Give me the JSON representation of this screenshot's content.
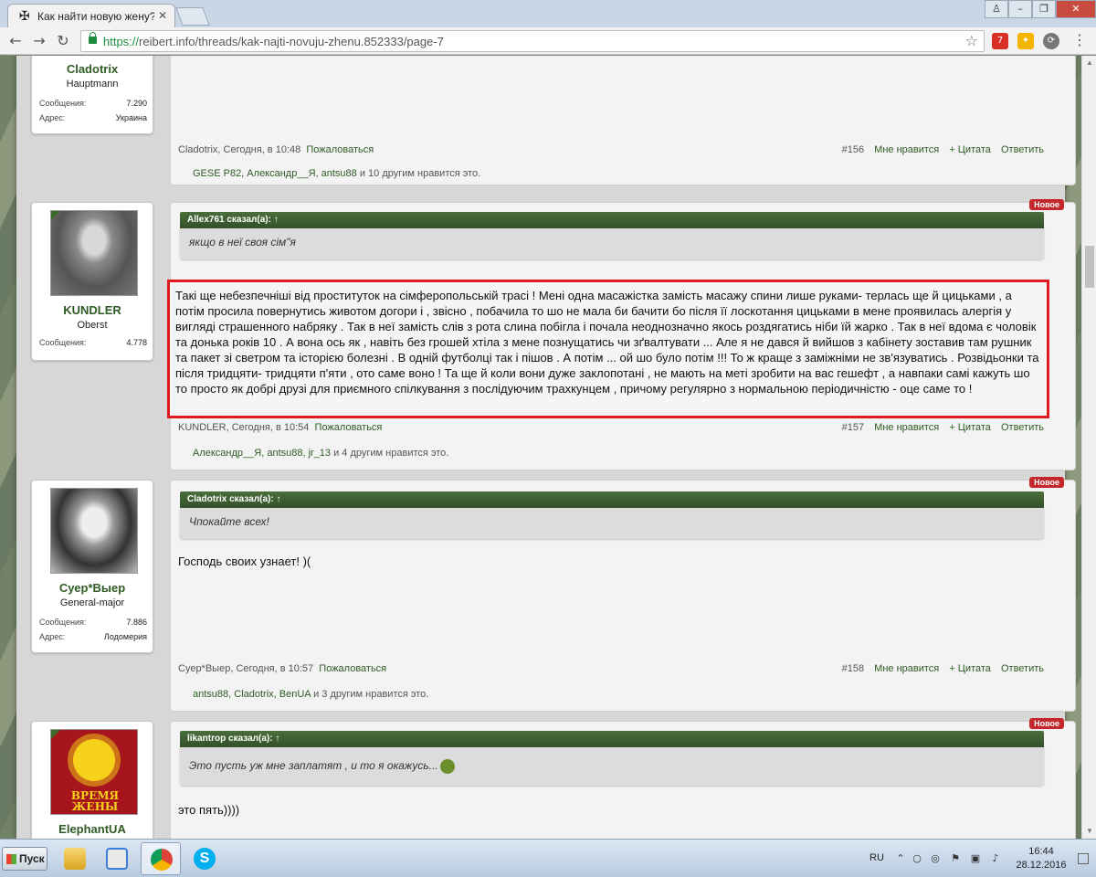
{
  "browser": {
    "tab_title": "Как найти новую жену?",
    "tab_icon": "iron-cross-icon",
    "url_scheme": "https://",
    "url_rest": "reibert.info/threads/kak-najti-novuju-zhenu.852333/page-7",
    "extension_badge": "7"
  },
  "labels": {
    "new_badge": "Новое",
    "report": "Пожаловаться",
    "like": "Мне нравится",
    "quote": "+ Цитата",
    "reply": "Ответить",
    "messages": "Сообщения:",
    "address": "Адрес:",
    "likes_suffix": "нравится это."
  },
  "posts": [
    {
      "user": {
        "name": "Cladotrix",
        "rank": "Hauptmann",
        "messages": "7.290",
        "address": "Украина"
      },
      "author": "Cladotrix",
      "time": "Сегодня, в 10:48",
      "number": "#156",
      "likes": "GESE P82, Александр__Я, antsu88 и 10 другим",
      "likes_names": "GESE P82, Александр__Я, antsu88",
      "likes_tail": " и 10 другим нравится это."
    },
    {
      "user": {
        "name": "KUNDLER",
        "rank": "Oberst",
        "messages": "4.778"
      },
      "quote_head": "Allex761 сказал(а): ↑",
      "quote_text": "якщо в неї своя сім\"я",
      "text": "Такі ще небезпечніші від проституток на сімферопольській трасі ! Мені одна масажістка замість масажу спини лише руками- терлась ще й цицьками , а потім просила повернутись животом догори і , звісно , побачила то шо не мала би бачити бо після її лоскотання цицьками в мене проявилась алергія у вигляді страшенного набряку . Так в неї замість слів з рота слина побігла і почала неоднозначно якось роздягатись ніби їй жарко . Так в неї вдома є чоловік та донька років 10 . А вона ось як , навіть без грошей хтіла з мене познущатись чи зґвалтувати ... Але я не дався й вийшов з кабінету зоставив там рушник та пакет зі светром та історією болезні . В одній футболці так і пішов . А потім ... ой шо було потім !!! То ж краще з заміжніми не зв'язуватись . Розвідьонки та після тридцяти- тридцяти п'яти , ото саме воно ! Та ще й коли вони дуже заклопотані , не мають на меті зробити на вас гешефт , а навпаки самі кажуть шо то просто як добрі друзі для приємного спілкування з послідуючим трахкунцем , причому регулярно з нормальною періодичністю - оце саме то !",
      "author": "KUNDLER",
      "time": "Сегодня, в 10:54",
      "number": "#157",
      "likes_names": "Александр__Я, antsu88, jr_13",
      "likes_tail": " и 4 другим нравится это."
    },
    {
      "user": {
        "name": "Суер*Выер",
        "rank": "General-major",
        "messages": "7.886",
        "address": "Лодомерия"
      },
      "quote_head": "Cladotrix сказал(а): ↑",
      "quote_text": "Чпокайте всех!",
      "text": "Господь своих узнает! )(",
      "author": "Суер*Выер",
      "time": "Сегодня, в 10:57",
      "number": "#158",
      "likes_names": "antsu88, Cladotrix, BenUA",
      "likes_tail": " и 3 другим нравится это."
    },
    {
      "user": {
        "name": "ElephantUA",
        "avatar_text": "ВРЕМЯ ЖЕНЫ"
      },
      "quote_head": "likantrop сказал(а): ↑",
      "quote_text": "Это пусть уж мне заплатят , и то я окажусь...",
      "text": "это пять))))"
    }
  ],
  "taskbar": {
    "start": "Пуск",
    "lang": "RU",
    "time": "16:44",
    "date": "28.12.2016"
  },
  "colors": {
    "accent_green": "#2e5c24",
    "new_badge": "#c3272b",
    "highlight_border": "#e0191f"
  }
}
